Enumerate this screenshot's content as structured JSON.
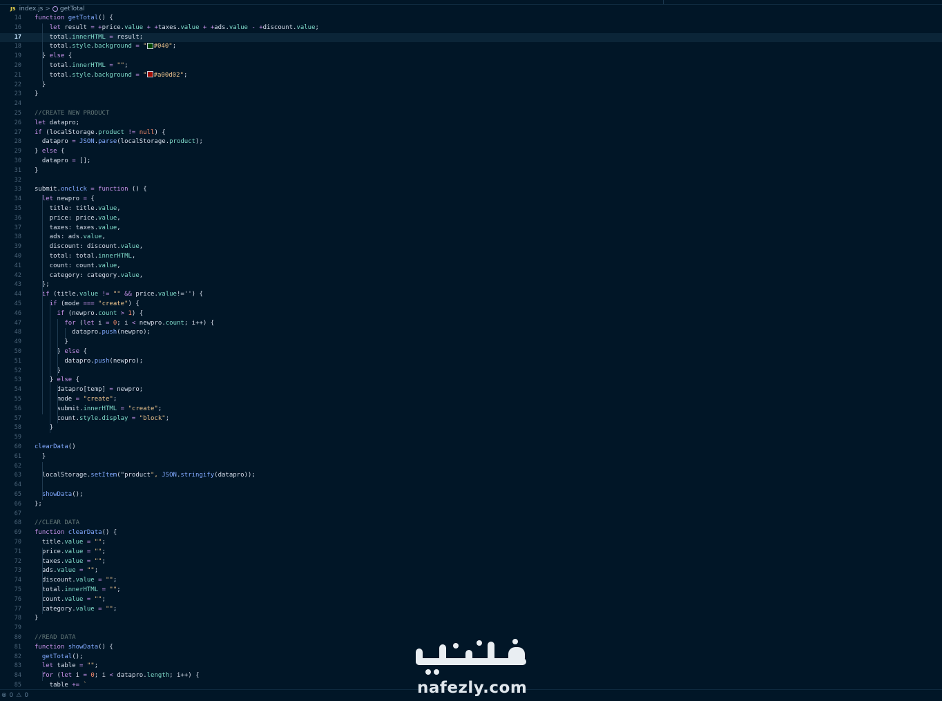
{
  "breadcrumb": {
    "file_icon": "JS",
    "file": "index.js",
    "separator": ">",
    "symbol": "getTotal"
  },
  "editor": {
    "current_line": 17,
    "lines": [
      {
        "n": "14",
        "code": "function getTotal() {"
      },
      {
        "n": "16",
        "code": "    let result = +price.value + +taxes.value + +ads.value - +discount.value;"
      },
      {
        "n": "17",
        "code": "    total.innerHTML = result;"
      },
      {
        "n": "18",
        "code": "    total.style.background = \"#040\";"
      },
      {
        "n": "19",
        "code": "  } else {"
      },
      {
        "n": "20",
        "code": "    total.innerHTML = \"\";"
      },
      {
        "n": "21",
        "code": "    total.style.background = \"#a00d02\";"
      },
      {
        "n": "22",
        "code": "  }"
      },
      {
        "n": "23",
        "code": "}"
      },
      {
        "n": "24",
        "code": ""
      },
      {
        "n": "25",
        "code": "//CREATE NEW PRODUCT"
      },
      {
        "n": "26",
        "code": "let datapro;"
      },
      {
        "n": "27",
        "code": "if (localStorage.product != null) {"
      },
      {
        "n": "28",
        "code": "  datapro = JSON.parse(localStorage.product);"
      },
      {
        "n": "29",
        "code": "} else {"
      },
      {
        "n": "30",
        "code": "  datapro = [];"
      },
      {
        "n": "31",
        "code": "}"
      },
      {
        "n": "32",
        "code": ""
      },
      {
        "n": "33",
        "code": "submit.onclick = function () {"
      },
      {
        "n": "34",
        "code": "  let newpro = {"
      },
      {
        "n": "35",
        "code": "    title: title.value,"
      },
      {
        "n": "36",
        "code": "    price: price.value,"
      },
      {
        "n": "37",
        "code": "    taxes: taxes.value,"
      },
      {
        "n": "38",
        "code": "    ads: ads.value,"
      },
      {
        "n": "39",
        "code": "    discount: discount.value,"
      },
      {
        "n": "40",
        "code": "    total: total.innerHTML,"
      },
      {
        "n": "41",
        "code": "    count: count.value,"
      },
      {
        "n": "42",
        "code": "    category: category.value,"
      },
      {
        "n": "43",
        "code": "  };"
      },
      {
        "n": "44",
        "code": "  if (title.value != \"\" && price.value!='') {"
      },
      {
        "n": "45",
        "code": "    if (mode === \"create\") {"
      },
      {
        "n": "46",
        "code": "      if (newpro.count > 1) {"
      },
      {
        "n": "47",
        "code": "        for (let i = 0; i < newpro.count; i++) {"
      },
      {
        "n": "48",
        "code": "          datapro.push(newpro);"
      },
      {
        "n": "49",
        "code": "        }"
      },
      {
        "n": "50",
        "code": "      } else {"
      },
      {
        "n": "51",
        "code": "        datapro.push(newpro);"
      },
      {
        "n": "52",
        "code": "      }"
      },
      {
        "n": "53",
        "code": "    } else {"
      },
      {
        "n": "54",
        "code": "      datapro[temp] = newpro;"
      },
      {
        "n": "55",
        "code": "      mode = \"create\";"
      },
      {
        "n": "56",
        "code": "      submit.innerHTML = \"create\";"
      },
      {
        "n": "57",
        "code": "      count.style.display = \"block\";"
      },
      {
        "n": "58",
        "code": "    }"
      },
      {
        "n": "59",
        "code": ""
      },
      {
        "n": "60",
        "code": "clearData()"
      },
      {
        "n": "61",
        "code": "  }"
      },
      {
        "n": "62",
        "code": ""
      },
      {
        "n": "63",
        "code": "  localStorage.setItem(\"product\", JSON.stringify(datapro));"
      },
      {
        "n": "64",
        "code": ""
      },
      {
        "n": "65",
        "code": "  showData();"
      },
      {
        "n": "66",
        "code": "};"
      },
      {
        "n": "67",
        "code": ""
      },
      {
        "n": "68",
        "code": "//CLEAR DATA"
      },
      {
        "n": "69",
        "code": "function clearData() {"
      },
      {
        "n": "70",
        "code": "  title.value = \"\";"
      },
      {
        "n": "71",
        "code": "  price.value = \"\";"
      },
      {
        "n": "72",
        "code": "  taxes.value = \"\";"
      },
      {
        "n": "73",
        "code": "  ads.value = \"\";"
      },
      {
        "n": "74",
        "code": "  discount.value = \"\";"
      },
      {
        "n": "75",
        "code": "  total.innerHTML = \"\";"
      },
      {
        "n": "76",
        "code": "  count.value = \"\";"
      },
      {
        "n": "77",
        "code": "  category.value = \"\";"
      },
      {
        "n": "78",
        "code": "}"
      },
      {
        "n": "79",
        "code": ""
      },
      {
        "n": "80",
        "code": "//READ DATA"
      },
      {
        "n": "81",
        "code": "function showData() {"
      },
      {
        "n": "82",
        "code": "  getTotal();"
      },
      {
        "n": "83",
        "code": "  let table = \"\";"
      },
      {
        "n": "84",
        "code": "  for (let i = 0; i < datapro.length; i++) {"
      },
      {
        "n": "85",
        "code": "    table += `"
      }
    ]
  },
  "color_swatches": {
    "line18": "#004400",
    "line21": "#a00d02"
  },
  "statusbar": {
    "errors_icon": "error-icon",
    "errors": "0",
    "warnings_icon": "warning-icon",
    "warnings": "0"
  },
  "watermark": {
    "arabic": "نفذلي",
    "latin": "nafezly.com"
  },
  "theme": {
    "background": "#011627",
    "keyword": "#c792ea",
    "function": "#82aaff",
    "property": "#7fdbca",
    "string": "#ecc48d",
    "number": "#f78c6c",
    "comment": "#637777"
  }
}
